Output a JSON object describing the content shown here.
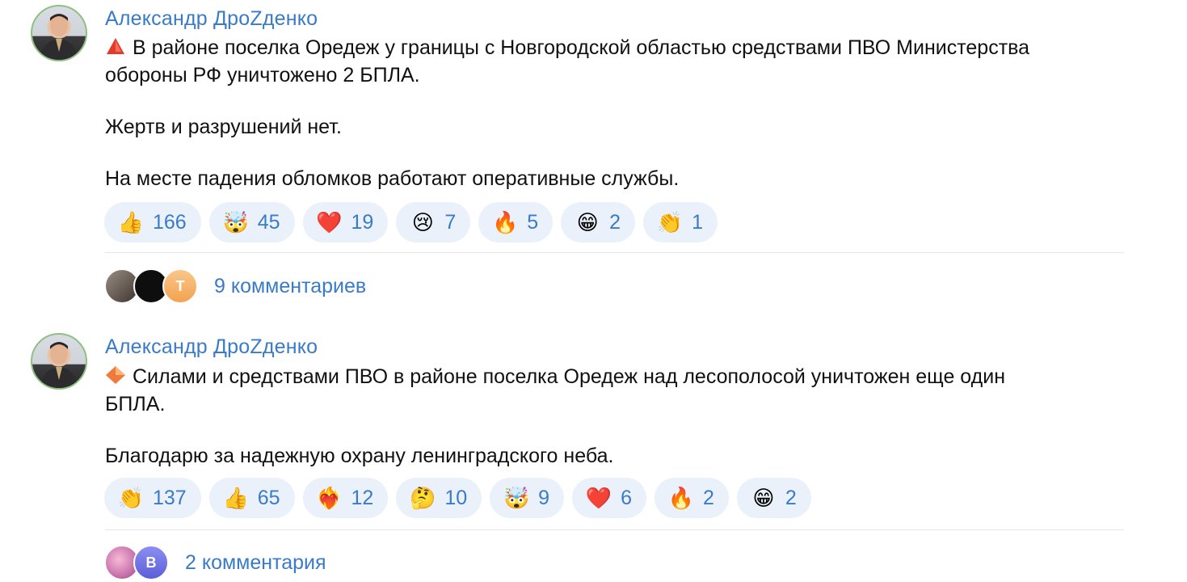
{
  "posts": [
    {
      "author": "Александр ДроZденко",
      "marker_icon": "red-triangle-icon",
      "paragraphs": [
        "В районе поселка Оредеж у границы с Новгородской областью средствами ПВО Министерства",
        "обороны РФ уничтожено 2 БПЛА.",
        "Жертв и разрушений нет.",
        "На месте падения обломков работают оперативные службы."
      ],
      "reactions": [
        {
          "emoji": "👍",
          "icon": "thumbs-up-icon",
          "count": "166"
        },
        {
          "emoji": "🤯",
          "icon": "exploding-head-icon",
          "count": "45"
        },
        {
          "emoji": "❤️",
          "icon": "red-heart-icon",
          "count": "19"
        },
        {
          "emoji": "😢",
          "icon": "crying-face-icon",
          "count": "7"
        },
        {
          "emoji": "🔥",
          "icon": "fire-icon",
          "count": "5"
        },
        {
          "emoji": "😁",
          "icon": "grinning-face-icon",
          "count": "2"
        },
        {
          "emoji": "👏",
          "icon": "clapping-hands-icon",
          "count": "1"
        }
      ],
      "comment_avatars": [
        "photo-avatar",
        "dark-avatar",
        "Т"
      ],
      "comments_label": "9 комментариев"
    },
    {
      "author": "Александр ДроZденко",
      "marker_icon": "orange-diamond-icon",
      "paragraphs": [
        "Силами и средствами ПВО в районе поселка Оредеж над лесополосой  уничтожен еще один",
        "БПЛА.",
        "Благодарю за надежную охрану ленинградского неба."
      ],
      "reactions": [
        {
          "emoji": "👏",
          "icon": "clapping-hands-icon",
          "count": "137"
        },
        {
          "emoji": "👍",
          "icon": "thumbs-up-icon",
          "count": "65"
        },
        {
          "emoji": "❤️‍🔥",
          "icon": "heart-on-fire-icon",
          "count": "12"
        },
        {
          "emoji": "🤔",
          "icon": "thinking-face-icon",
          "count": "10"
        },
        {
          "emoji": "🤯",
          "icon": "exploding-head-icon",
          "count": "9"
        },
        {
          "emoji": "❤️",
          "icon": "red-heart-icon",
          "count": "6"
        },
        {
          "emoji": "🔥",
          "icon": "fire-icon",
          "count": "2"
        },
        {
          "emoji": "😁",
          "icon": "grinning-face-icon",
          "count": "2"
        }
      ],
      "comment_avatars": [
        "pink-avatar",
        "В"
      ],
      "comments_label": "2 комментария"
    }
  ],
  "colors": {
    "link": "#3a7bc8",
    "chip_background": "#eaf1fa",
    "divider": "#e3e6ea",
    "avatar_ring": "#8fbf84"
  }
}
